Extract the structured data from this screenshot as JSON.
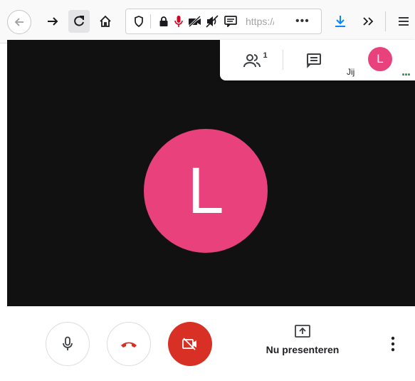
{
  "browser": {
    "url_text": "https://",
    "url_more": "•••",
    "icons": [
      "back-icon",
      "forward-icon",
      "reload-icon",
      "home-icon",
      "shield-icon",
      "lock-icon",
      "microphone-icon",
      "camera-off-icon",
      "speaker-off-icon",
      "message-icon",
      "download-icon",
      "overflow-icon",
      "menu-icon"
    ]
  },
  "meeting": {
    "avatar_letter": "L",
    "participants_count": "1",
    "self_label": "Jij",
    "self_initial": "L",
    "speaking_indicator": "...",
    "present_label": "Nu presenteren",
    "colors": {
      "avatar": "#e8417b",
      "hangup": "#d93025",
      "camera_off_bg": "#d93025",
      "speaking": "#1e8e3e",
      "stage": "#111111"
    }
  }
}
